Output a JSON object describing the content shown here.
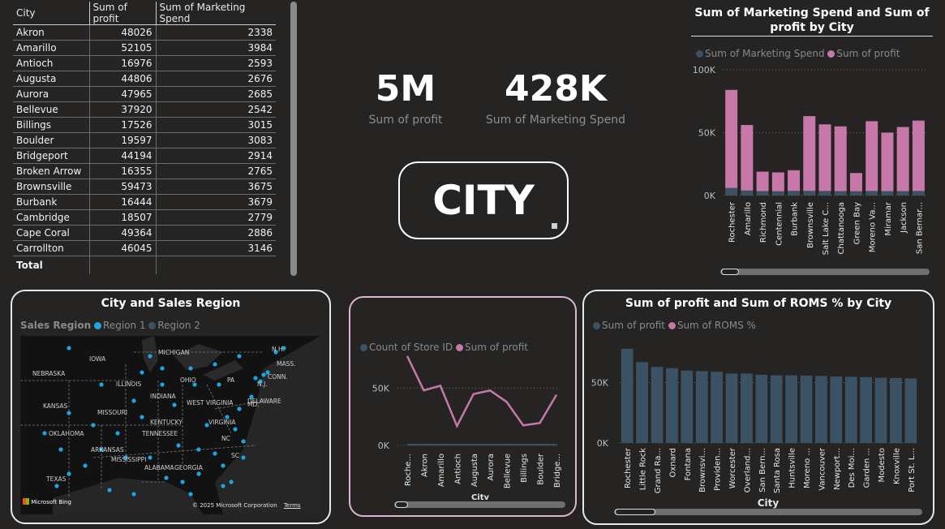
{
  "table": {
    "columns": [
      "City",
      "Sum of profit",
      "Sum of Marketing Spend"
    ],
    "rows": [
      [
        "Akron",
        "48026",
        "2338"
      ],
      [
        "Amarillo",
        "52105",
        "3984"
      ],
      [
        "Antioch",
        "16976",
        "2593"
      ],
      [
        "Augusta",
        "44806",
        "2676"
      ],
      [
        "Aurora",
        "47965",
        "2685"
      ],
      [
        "Bellevue",
        "37920",
        "2542"
      ],
      [
        "Billings",
        "17526",
        "3015"
      ],
      [
        "Boulder",
        "19597",
        "3083"
      ],
      [
        "Bridgeport",
        "44194",
        "2914"
      ],
      [
        "Broken Arrow",
        "16355",
        "2765"
      ],
      [
        "Brownsville",
        "59473",
        "3675"
      ],
      [
        "Burbank",
        "16444",
        "3679"
      ],
      [
        "Cambridge",
        "18507",
        "2779"
      ],
      [
        "Cape Coral",
        "49364",
        "2886"
      ],
      [
        "Carrollton",
        "46045",
        "3146"
      ]
    ],
    "total_label": "Total"
  },
  "kpis": {
    "profit_value": "5M",
    "profit_label": "Sum of profit",
    "marketing_value": "428K",
    "marketing_label": "Sum of Marketing Spend"
  },
  "city_button": {
    "label": "CITY"
  },
  "map_panel": {
    "title": "City and Sales Region",
    "legend_title": "Sales Region",
    "legend_items": [
      "Region 1",
      "Region 2"
    ],
    "state_labels": [
      "IOWA",
      "MICHIGAN",
      "NEBRASKA",
      "ILLINOIS",
      "OHIO",
      "PA",
      "INDIANA",
      "KANSAS",
      "MISSOURI",
      "WEST VIRGINIA",
      "KENTUCKY",
      "VIRGINIA",
      "OKLAHOMA",
      "TENNESSEE",
      "NC",
      "ARKANSAS",
      "SC",
      "MISSISSIPPI",
      "ALABAMA",
      "GEORGIA",
      "TEXAS",
      "N.H.",
      "MASS.",
      "CONN.",
      "N.J.",
      "MD.",
      "DELAWARE"
    ],
    "bing_label": "Microsoft Bing",
    "copyright": "© 2025 Microsoft Corporation",
    "terms": "Terms"
  },
  "colors": {
    "profit": "#c778a8",
    "marketing": "#3b5265",
    "region1": "#1aa6e2",
    "region2": "#3b5265",
    "background": "#252423"
  },
  "chart_data": [
    {
      "type": "bar",
      "title": "Sum of Marketing Spend and Sum of profit by City",
      "stacked": true,
      "categories": [
        "Rochester",
        "Amarillo",
        "Richmond",
        "Centennial",
        "Burbank",
        "Brownsville",
        "Salt Lake C...",
        "Chattanooga",
        "Green Bay",
        "Moreno Va...",
        "Miramar",
        "Jackson",
        "San Bernar..."
      ],
      "series": [
        {
          "name": "Sum of Marketing Spend",
          "values": [
            6000,
            3984,
            3500,
            3400,
            3679,
            3675,
            3600,
            3500,
            3400,
            3600,
            3500,
            3500,
            3600
          ]
        },
        {
          "name": "Sum of profit",
          "values": [
            78000,
            52105,
            15500,
            15000,
            16444,
            59473,
            53000,
            51500,
            14500,
            55500,
            46500,
            51000,
            56000
          ]
        }
      ],
      "ylim": [
        0,
        100000
      ],
      "yticks": [
        "0K",
        "50K",
        "100K"
      ],
      "legend": "top-left"
    },
    {
      "type": "line",
      "title": "",
      "xlabel": "City",
      "categories": [
        "Roche...",
        "Akron",
        "Amarillo",
        "Antioch",
        "Augusta",
        "Aurora",
        "Bellevue",
        "Billings",
        "Boulder",
        "Bridge..."
      ],
      "series": [
        {
          "name": "Count of Store ID",
          "values": [
            1,
            1,
            1,
            1,
            1,
            1,
            1,
            1,
            1,
            1
          ]
        },
        {
          "name": "Sum of profit",
          "values": [
            78000,
            48026,
            52105,
            16976,
            44806,
            47965,
            37920,
            17526,
            19597,
            44194
          ]
        }
      ],
      "ylim": [
        0,
        100000
      ],
      "yticks": [
        "0K",
        "50K"
      ],
      "legend": "top-left"
    },
    {
      "type": "bar",
      "title": "Sum of profit and Sum of ROMS % by City",
      "xlabel": "City",
      "categories": [
        "Rochester",
        "Little Rock",
        "Grand Ra...",
        "Oxnard",
        "Fontana",
        "Brownsvi...",
        "Providen...",
        "Worcester",
        "Overland...",
        "San Bern...",
        "Santa Rosa",
        "Huntsville",
        "Moreno ...",
        "Vancouver",
        "Newport...",
        "Des Moi...",
        "Garden ...",
        "Modesto",
        "Knoxville",
        "Port St. L..."
      ],
      "series": [
        {
          "name": "Sum of profit",
          "values": [
            78000,
            67000,
            63000,
            62000,
            60000,
            59500,
            59000,
            57500,
            57500,
            56500,
            56000,
            56000,
            55800,
            55500,
            55000,
            54800,
            54500,
            54000,
            53800,
            53500
          ]
        },
        {
          "name": "Sum of ROMS %",
          "values": []
        }
      ],
      "ylim": [
        0,
        90000
      ],
      "yticks": [
        "0K",
        "50K"
      ],
      "legend": "top-left"
    }
  ]
}
